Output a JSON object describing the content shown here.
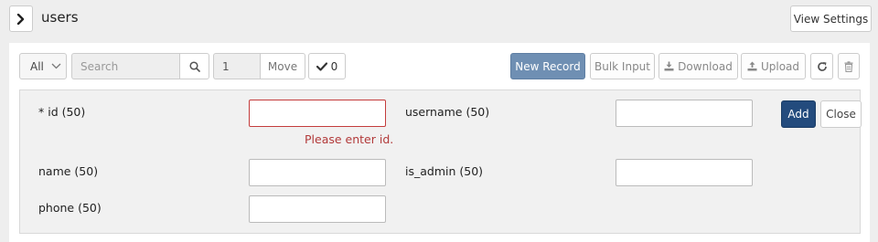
{
  "header": {
    "title": "users",
    "view_settings_label": "View Settings"
  },
  "toolbar": {
    "filter_selected": "All",
    "search_placeholder": "Search",
    "page_value": "1",
    "move_label": "Move",
    "selected_count": "0",
    "new_record_label": "New Record",
    "bulk_input_label": "Bulk Input",
    "download_label": "Download",
    "upload_label": "Upload"
  },
  "form": {
    "fields": [
      {
        "label": "* id (50)",
        "value": ""
      },
      {
        "label": "username (50)",
        "value": ""
      },
      {
        "label": "name (50)",
        "value": ""
      },
      {
        "label": "is_admin (50)",
        "value": ""
      },
      {
        "label": "phone (50)",
        "value": ""
      }
    ],
    "id_error": "Please enter id.",
    "add_label": "Add",
    "close_label": "Close"
  },
  "colors": {
    "primary": "#6f8fb3",
    "add_button": "#234b7d",
    "error": "#c43c3c"
  },
  "icons": [
    "chevron-right-icon",
    "chevron-down-icon",
    "search-icon",
    "check-icon",
    "download-icon",
    "upload-icon",
    "refresh-icon",
    "trash-icon"
  ]
}
